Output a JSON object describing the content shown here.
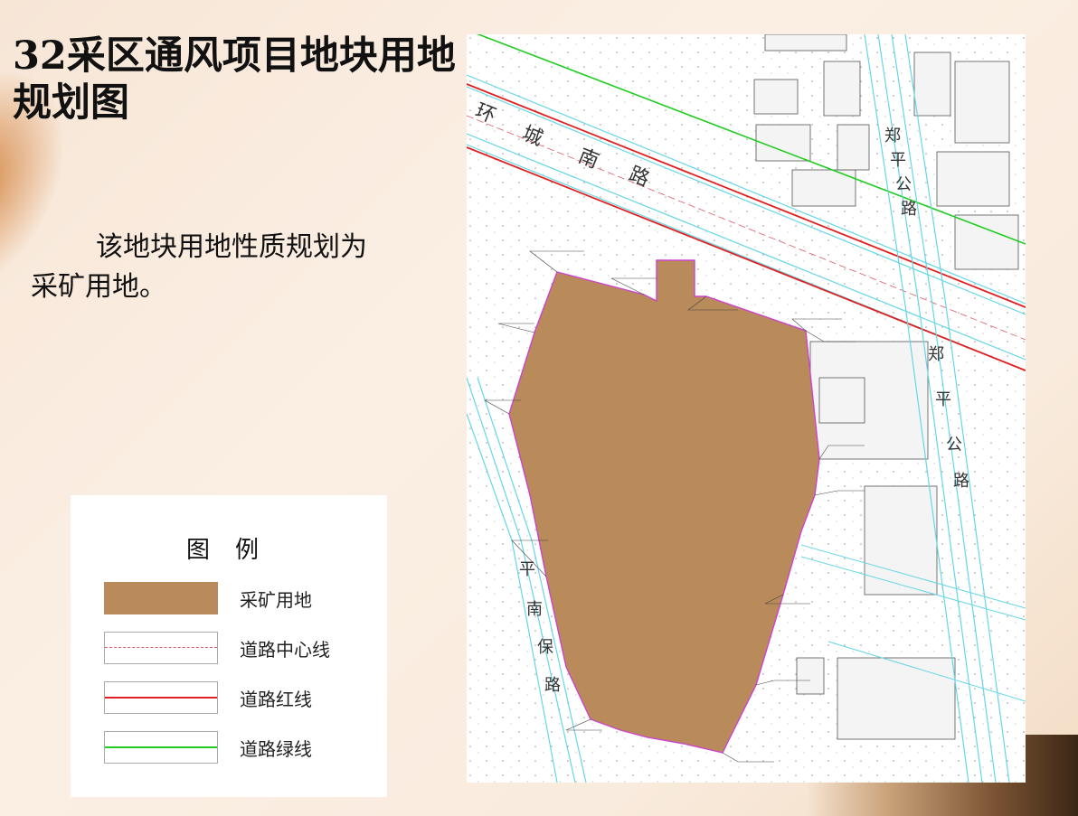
{
  "title": "32采区通风项目地块用地规划图",
  "description": "该地块用地性质规划为采矿用地。",
  "legend": {
    "title": "图例",
    "items": [
      {
        "label": "采矿用地",
        "color": "#b98a5a"
      },
      {
        "label": "道路中心线",
        "color": "#e05a6a"
      },
      {
        "label": "道路红线",
        "color": "#e02020"
      },
      {
        "label": "道路绿线",
        "color": "#22cc22"
      }
    ]
  },
  "map": {
    "road_labels": {
      "south_ring_road": [
        "环",
        "城",
        "南",
        "路"
      ],
      "zhengping_road_north": [
        "郑",
        "平",
        "公",
        "路"
      ],
      "zhengping_road_south": [
        "郑",
        "平",
        "公",
        "路"
      ],
      "pingnan_road": [
        "平",
        "南",
        "保",
        "路"
      ]
    },
    "colors": {
      "mining_land": "#b98a5a",
      "road_edge": "#66d6e6",
      "red_line": "#e02020",
      "green_line": "#22cc22",
      "boundary": "#cc44cc"
    }
  }
}
